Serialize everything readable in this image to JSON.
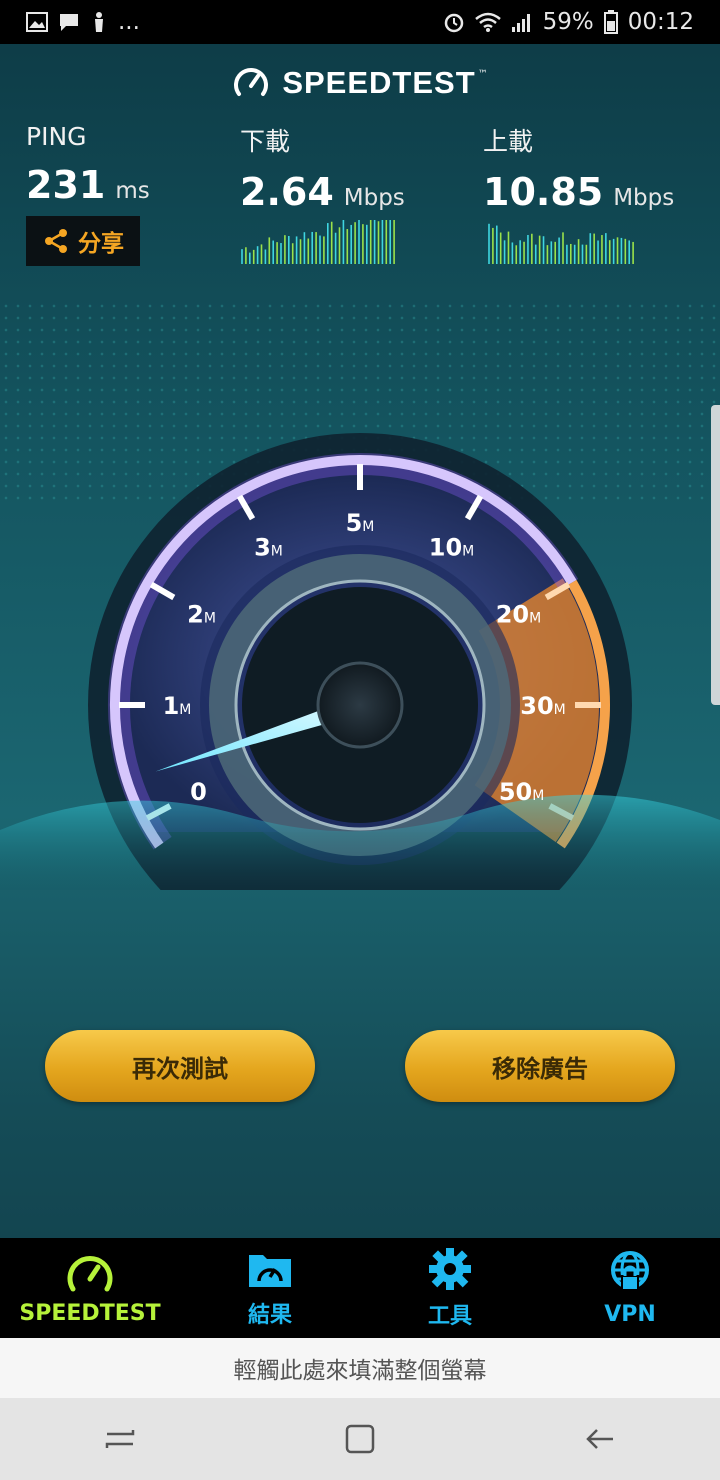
{
  "status_bar": {
    "icons_left": [
      "image-icon",
      "message-icon",
      "touch-icon"
    ],
    "overflow": "...",
    "battery": "59%",
    "time": "00:12"
  },
  "header": {
    "title": "SPEEDTEST",
    "tm": "™"
  },
  "stats": {
    "ping": {
      "label": "PING",
      "value": "231",
      "unit": "ms"
    },
    "download": {
      "label": "下載",
      "value": "2.64",
      "unit": "Mbps"
    },
    "upload": {
      "label": "上載",
      "value": "10.85",
      "unit": "Mbps"
    }
  },
  "share": {
    "label": "分享"
  },
  "gauge": {
    "labels": [
      {
        "num": "0",
        "unit": ""
      },
      {
        "num": "1",
        "unit": "M"
      },
      {
        "num": "2",
        "unit": "M"
      },
      {
        "num": "3",
        "unit": "M"
      },
      {
        "num": "5",
        "unit": "M"
      },
      {
        "num": "10",
        "unit": "M"
      },
      {
        "num": "20",
        "unit": "M"
      },
      {
        "num": "30",
        "unit": "M"
      },
      {
        "num": "50",
        "unit": "M"
      }
    ],
    "colors": {
      "arc": "#ffffff",
      "purple": "#8a5cf5",
      "orange": "#f08a2a"
    }
  },
  "buttons": {
    "retest": "再次測試",
    "remove_ads": "移除廣告"
  },
  "bottom_nav": [
    {
      "label": "SPEEDTEST",
      "icon": "speedometer-icon",
      "active": true
    },
    {
      "label": "結果",
      "icon": "results-folder-icon",
      "active": false
    },
    {
      "label": "工具",
      "icon": "gear-icon",
      "active": false
    },
    {
      "label": "VPN",
      "icon": "vpn-globe-lock-icon",
      "active": false
    }
  ],
  "ad_bar": {
    "text": "輕觸此處來填滿整個螢幕"
  },
  "system_nav": [
    "recents-icon",
    "home-icon",
    "back-icon"
  ]
}
